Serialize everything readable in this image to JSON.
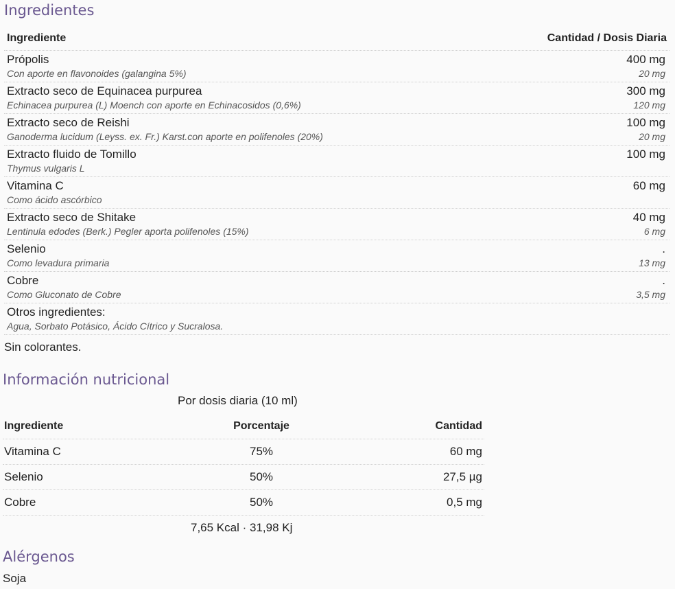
{
  "ingredients_section": {
    "title": "Ingredientes",
    "header": {
      "col1": "Ingrediente",
      "col2": "Cantidad / Dosis Diaria"
    },
    "rows": [
      {
        "name": "Própolis",
        "desc": "Con aporte en flavonoides (galangina 5%)",
        "amount": "400 mg",
        "sub_amount": "20 mg"
      },
      {
        "name": "Extracto seco de Equinacea purpurea",
        "desc": "Echinacea purpurea (L) Moench con aporte en Echinacosidos (0,6%)",
        "amount": "300 mg",
        "sub_amount": "120 mg"
      },
      {
        "name": "Extracto seco de Reishi",
        "desc": "Ganoderma lucidum (Leyss. ex. Fr.) Karst.con aporte en polifenoles (20%)",
        "amount": "100 mg",
        "sub_amount": "20 mg"
      },
      {
        "name": "Extracto fluido de Tomillo",
        "desc": "Thymus vulgaris L",
        "amount": "100 mg",
        "sub_amount": ""
      },
      {
        "name": "Vitamina C",
        "desc": "Como ácido ascórbico",
        "amount": "60 mg",
        "sub_amount": ""
      },
      {
        "name": "Extracto seco de Shitake",
        "desc": "Lentinula edodes (Berk.) Pegler aporta polifenoles (15%)",
        "amount": "40 mg",
        "sub_amount": "6 mg"
      },
      {
        "name": "Selenio",
        "desc": "Como levadura primaria",
        "amount": ".",
        "sub_amount": "13 mg"
      },
      {
        "name": "Cobre",
        "desc": "Como Gluconato de Cobre",
        "amount": ".",
        "sub_amount": "3,5 mg"
      },
      {
        "name": "Otros ingredientes:",
        "desc": "Agua, Sorbato Potásico, Ácido Cítrico y Sucralosa.",
        "amount": "",
        "sub_amount": ""
      }
    ],
    "note": "Sin colorantes."
  },
  "nutrition_section": {
    "title": "Información nutricional",
    "dose": "Por dosis diaria (10 ml)",
    "header": {
      "col1": "Ingrediente",
      "col2": "Porcentaje",
      "col3": "Cantidad"
    },
    "rows": [
      {
        "name": "Vitamina C",
        "percent": "75%",
        "amount": "60 mg"
      },
      {
        "name": "Selenio",
        "percent": "50%",
        "amount": "27,5 µg"
      },
      {
        "name": "Cobre",
        "percent": "50%",
        "amount": "0,5 mg"
      }
    ],
    "energy": "7,65 Kcal · 31,98 Kj"
  },
  "allergens_section": {
    "title": "Alérgenos",
    "text": "Soja"
  }
}
